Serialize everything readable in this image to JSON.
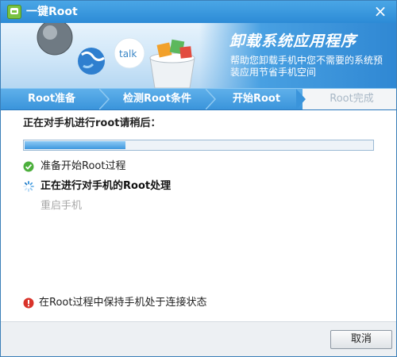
{
  "window": {
    "title": "一键Root",
    "close_label": "×"
  },
  "banner": {
    "title": "卸载系统应用程序",
    "description": "帮助您卸载手机中您不需要的系统预装应用节省手机空间",
    "art_label": "talk"
  },
  "steps": [
    {
      "label": "Root准备",
      "state": "done"
    },
    {
      "label": "检测Root条件",
      "state": "done"
    },
    {
      "label": "开始Root",
      "state": "active"
    },
    {
      "label": "Root完成",
      "state": "pending"
    }
  ],
  "status": {
    "title": "正在对手机进行root请稍后：",
    "progress": 0.29
  },
  "tasks": [
    {
      "label": "准备开始Root过程",
      "state": "done",
      "icon": "check-circle-icon"
    },
    {
      "label": "正在进行对手机的Root处理",
      "state": "in-progress",
      "icon": "spinner-icon"
    },
    {
      "label": "重启手机",
      "state": "pending",
      "icon": "none"
    }
  ],
  "warning": {
    "text": "在Root过程中保持手机处于连接状态",
    "icon": "alert-circle-icon"
  },
  "footer": {
    "cancel_label": "取消"
  },
  "colors": {
    "accent": "#2c8bd6",
    "step_bar": "#3a94db",
    "progress_fill": "#3f98de",
    "success": "#4caf3c",
    "warning": "#d9332a"
  }
}
